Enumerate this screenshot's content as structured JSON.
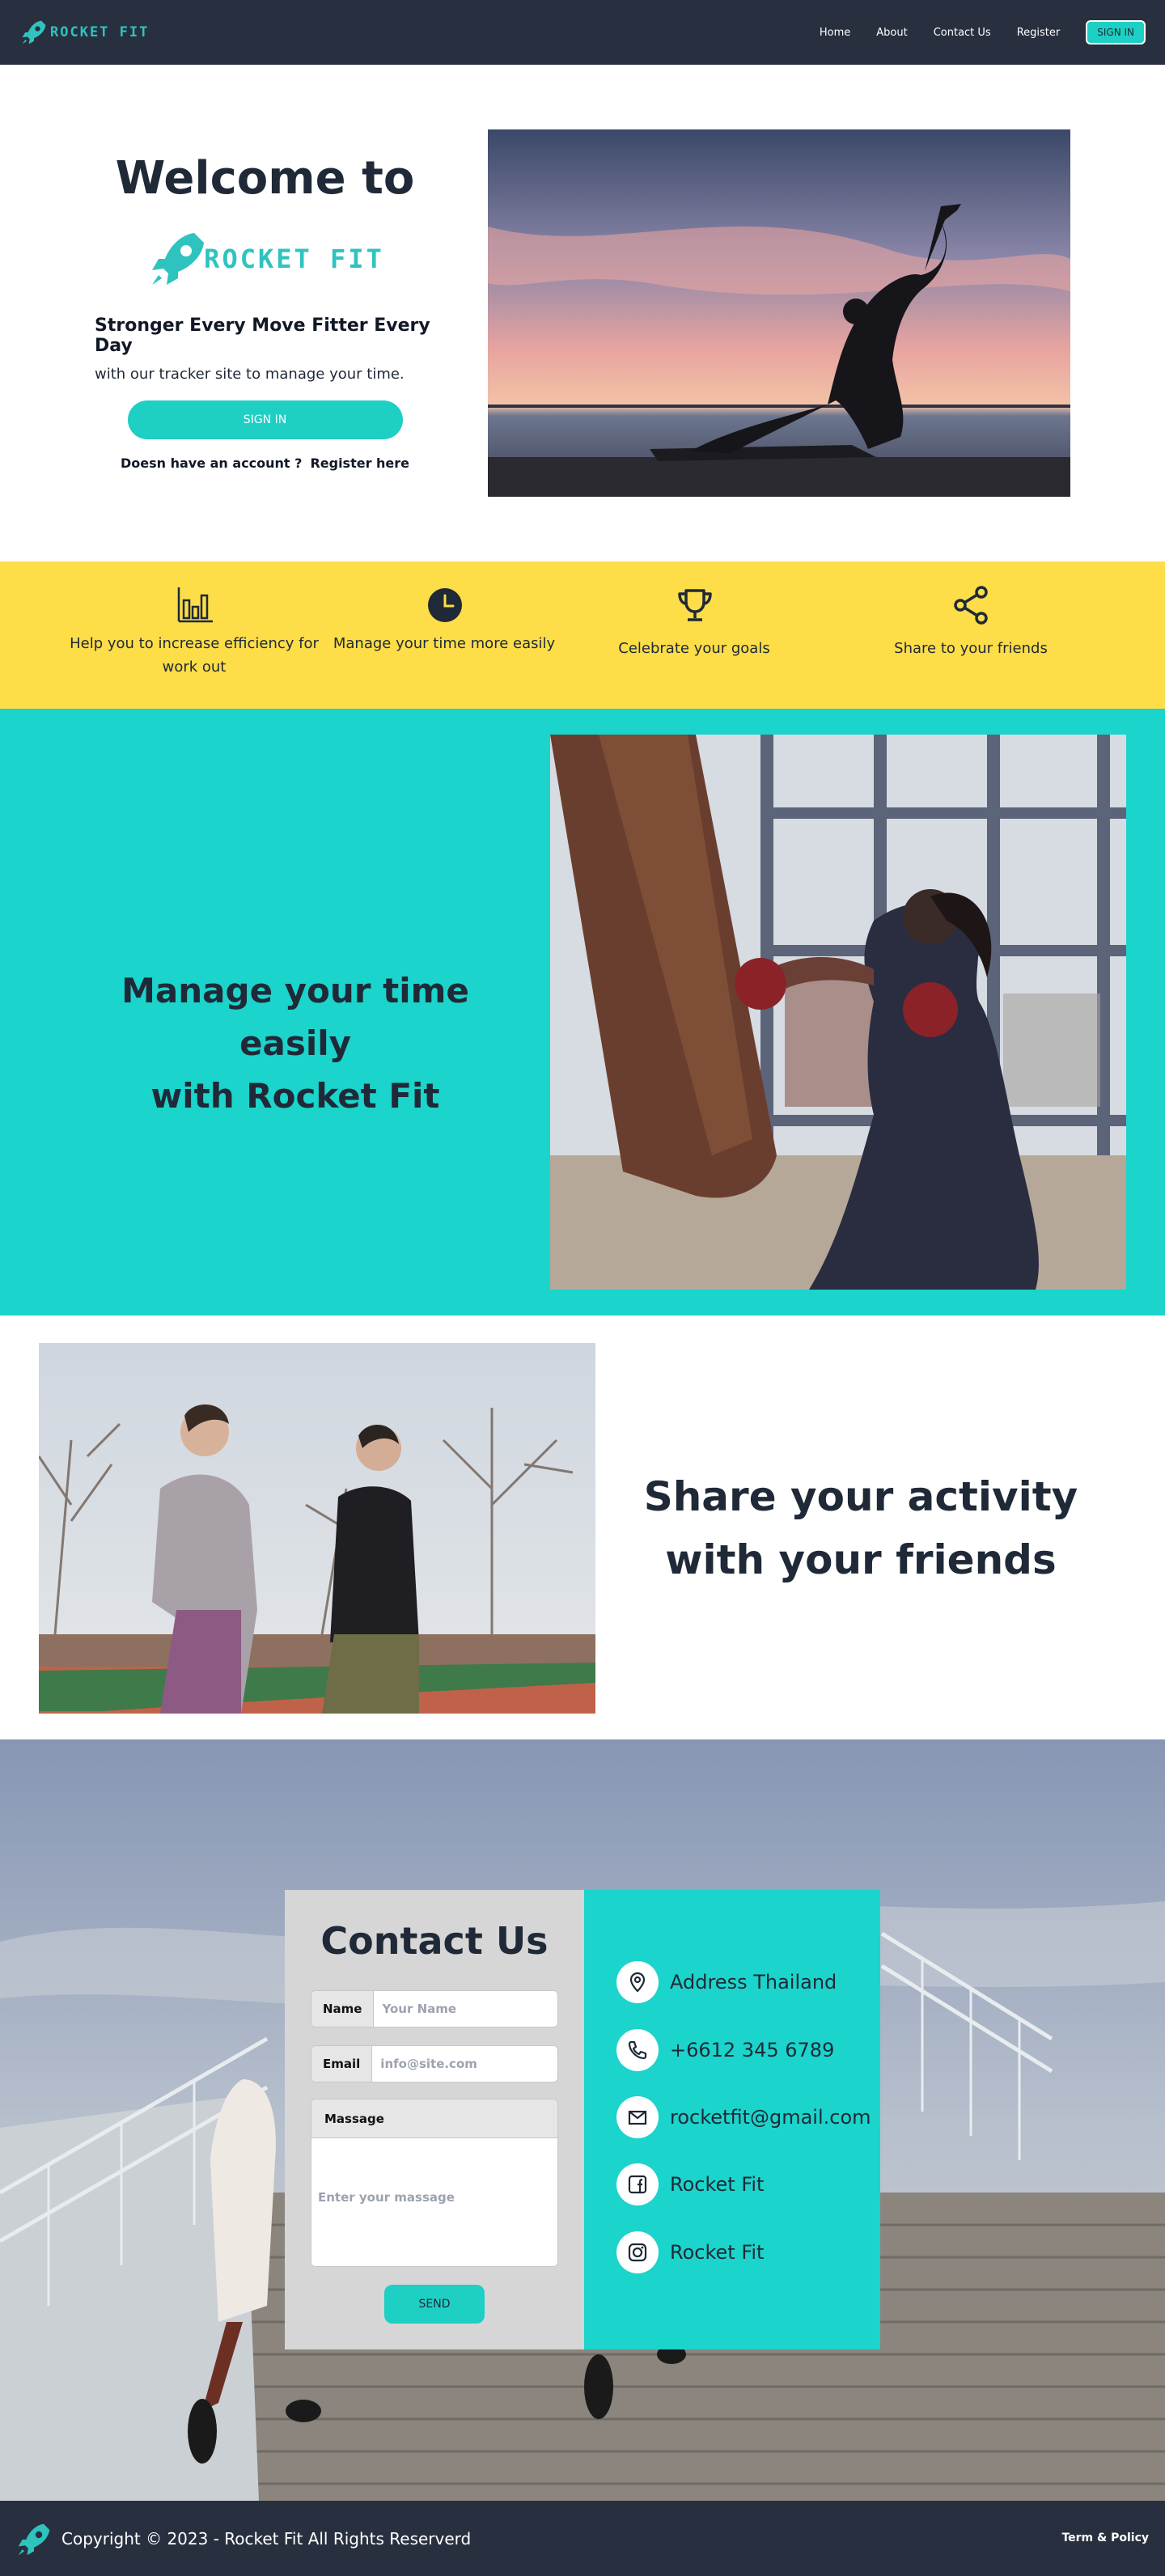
{
  "nav": {
    "brand": "ROCKET FIT",
    "links": [
      "Home",
      "About",
      "Contact Us",
      "Register"
    ],
    "signin": "SIGN IN"
  },
  "hero": {
    "title": "Welcome to",
    "logo_text": "ROCKET FIT",
    "tagline": "Stronger Every Move Fitter Every Day",
    "subtitle": "with our tracker site to manage your time.",
    "signin": "SIGN IN",
    "no_account": "Doesn have an account ?",
    "register": "Register here"
  },
  "features": [
    {
      "icon": "bar-chart-icon",
      "text": "Help you to increase efficiency for work out"
    },
    {
      "icon": "clock-icon",
      "text": "Manage your time more easily"
    },
    {
      "icon": "trophy-icon",
      "text": "Celebrate your goals"
    },
    {
      "icon": "share-icon",
      "text": "Share to your friends"
    }
  ],
  "manage": {
    "title_line1": "Manage your time easily",
    "title_line2": "with Rocket Fit"
  },
  "share": {
    "title_line1": "Share your activity",
    "title_line2": "with your friends"
  },
  "contact": {
    "title": "Contact Us",
    "name_label": "Name",
    "name_placeholder": "Your Name",
    "email_label": "Email",
    "email_placeholder": "info@site.com",
    "message_label": "Massage",
    "message_placeholder": "Enter your massage",
    "send": "SEND",
    "info": [
      {
        "icon": "location-pin-icon",
        "text": "Address Thailand"
      },
      {
        "icon": "phone-icon",
        "text": "+6612 345 6789"
      },
      {
        "icon": "mail-icon",
        "text": "rocketfit@gmail.com"
      },
      {
        "icon": "facebook-icon",
        "text": "Rocket Fit"
      },
      {
        "icon": "instagram-icon",
        "text": "Rocket Fit"
      }
    ]
  },
  "footer": {
    "copyright": "Copyright © 2023 - Rocket Fit All Rights Reserverd",
    "terms": "Term & Policy"
  },
  "colors": {
    "nav_bg": "#283040",
    "accent_teal": "#1ecfc4",
    "yellow": "#fddd48",
    "text_dark": "#1f2937"
  }
}
